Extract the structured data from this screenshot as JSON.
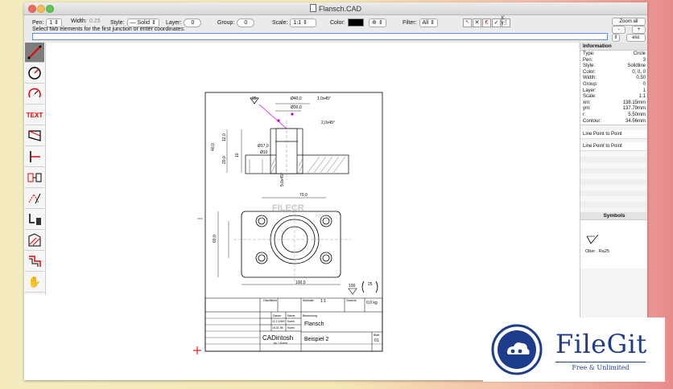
{
  "window": {
    "title": "Flansch.CAD"
  },
  "toolbar": {
    "pen_label": "Pen:",
    "pen_value": "1",
    "width_label": "Width:",
    "width_value": "0.25",
    "style_label": "Style:",
    "style_value": "Solid",
    "layer_label": "Layer:",
    "layer_value": "0",
    "group_label": "Group:",
    "group_value": "0",
    "scale_label": "Scale:",
    "scale_value": "1:1",
    "color_label": "Color:",
    "filter_label": "Filter:",
    "filter_value": "All",
    "x_label": "X:",
    "y_label": "Y:",
    "zoom_all": "Zoom all",
    "minus": "-",
    "plus": "+",
    "esc": "esc",
    "prompt": "Select two elements for the first junction or enter coordinates:",
    "command_value": ""
  },
  "info": {
    "header": "Information",
    "rows": [
      {
        "key": "Type:",
        "value": "Circle"
      },
      {
        "key": "Pen:",
        "value": "3"
      },
      {
        "key": "Style:",
        "value": "Solidline"
      },
      {
        "key": "Color:",
        "value": "0, 0, 0"
      },
      {
        "key": "Width:",
        "value": "0.50"
      },
      {
        "key": "Group:",
        "value": "0"
      },
      {
        "key": "Layer:",
        "value": "1"
      },
      {
        "key": "Scale:",
        "value": "1:1"
      },
      {
        "key": "xm:",
        "value": "138.15mm"
      },
      {
        "key": "ym:",
        "value": "137.79mm"
      },
      {
        "key": "r:",
        "value": "5.50mm"
      },
      {
        "key": "Contour:",
        "value": "34.56mm"
      }
    ],
    "list": [
      "Line Point to Point",
      "Line Point to Point"
    ]
  },
  "symbols": {
    "header": "Symbols",
    "item_label": "Ober . Ra25"
  },
  "tools": [
    "line-tool-icon",
    "circle-tool-icon",
    "arc-tool-icon",
    "text-tool-icon",
    "trim-tool-icon",
    "junction-tool-icon",
    "copy-tool-icon",
    "edit-tool-icon",
    "delete-tool-icon",
    "hatch-tool-icon",
    "contour-tool-icon",
    "hand-tool-icon"
  ],
  "drawing": {
    "dims": {
      "d40": "Ø40,0",
      "d30": "Ø30,0",
      "d17": "Ø17,0",
      "d10": "Ø10",
      "c1": "1,0x45°",
      "c2": "2,0x45°",
      "c3": "5,0x45°",
      "h40": "40,0",
      "h12": "12,0",
      "h20": "20,0",
      "h10": "10",
      "w70": "70,0",
      "w100": "100,0",
      "h60": "60,0",
      "rough1": "25",
      "rough2": "100",
      "rough3": "25"
    },
    "titleblock": {
      "oberflache": "Oberfläche",
      "masstab": "Maßstab",
      "scale": "1:1",
      "gewicht": "Gewicht",
      "weight": "0,0 kg",
      "datum": "Datum",
      "name": "Name",
      "d1": "11.2.1999",
      "n1": "Kuehl",
      "d2": "15.01.95",
      "n2": "Kuehl",
      "benennung": "Benennung",
      "part": "Flansch",
      "company": "CADintosh",
      "company_sub": "by ?-Kuehl",
      "drawing_no": "Beispiel 2",
      "blatt": "Blatt",
      "sheet": "01"
    }
  },
  "watermark": {
    "text1": "FILECR",
    "text2": ".com"
  },
  "badge": {
    "name": "FileGit",
    "tagline": "Free & Unlimited"
  },
  "colors": {
    "accent": "#1d3c8c",
    "magenta": "#c800c8",
    "red": "#e21b1b"
  }
}
